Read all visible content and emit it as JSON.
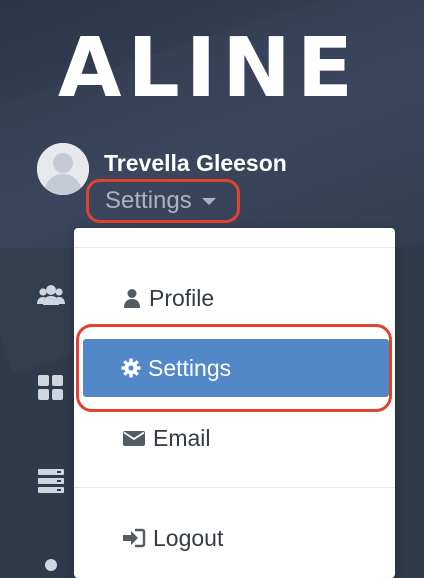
{
  "brand": {
    "logo_text": "ALINE"
  },
  "user": {
    "name": "Trevella Gleeson",
    "menu_toggle_label": "Settings"
  },
  "colors": {
    "sidebar_bg": "#2f3a4b",
    "highlight_ring": "#e0432e",
    "active_item_bg": "#5288c8",
    "muted_text": "#a8b4c4"
  },
  "sidebar": {
    "icons": [
      "users-icon",
      "dashboard-grid-icon",
      "server-stack-icon",
      "user-icon"
    ]
  },
  "dropdown": {
    "items": [
      {
        "label": "Profile",
        "icon": "user-icon"
      },
      {
        "label": "Settings",
        "icon": "gear-icon",
        "active": true
      },
      {
        "label": "Email",
        "icon": "envelope-icon"
      },
      {
        "label": "Logout",
        "icon": "sign-out-icon"
      }
    ]
  }
}
